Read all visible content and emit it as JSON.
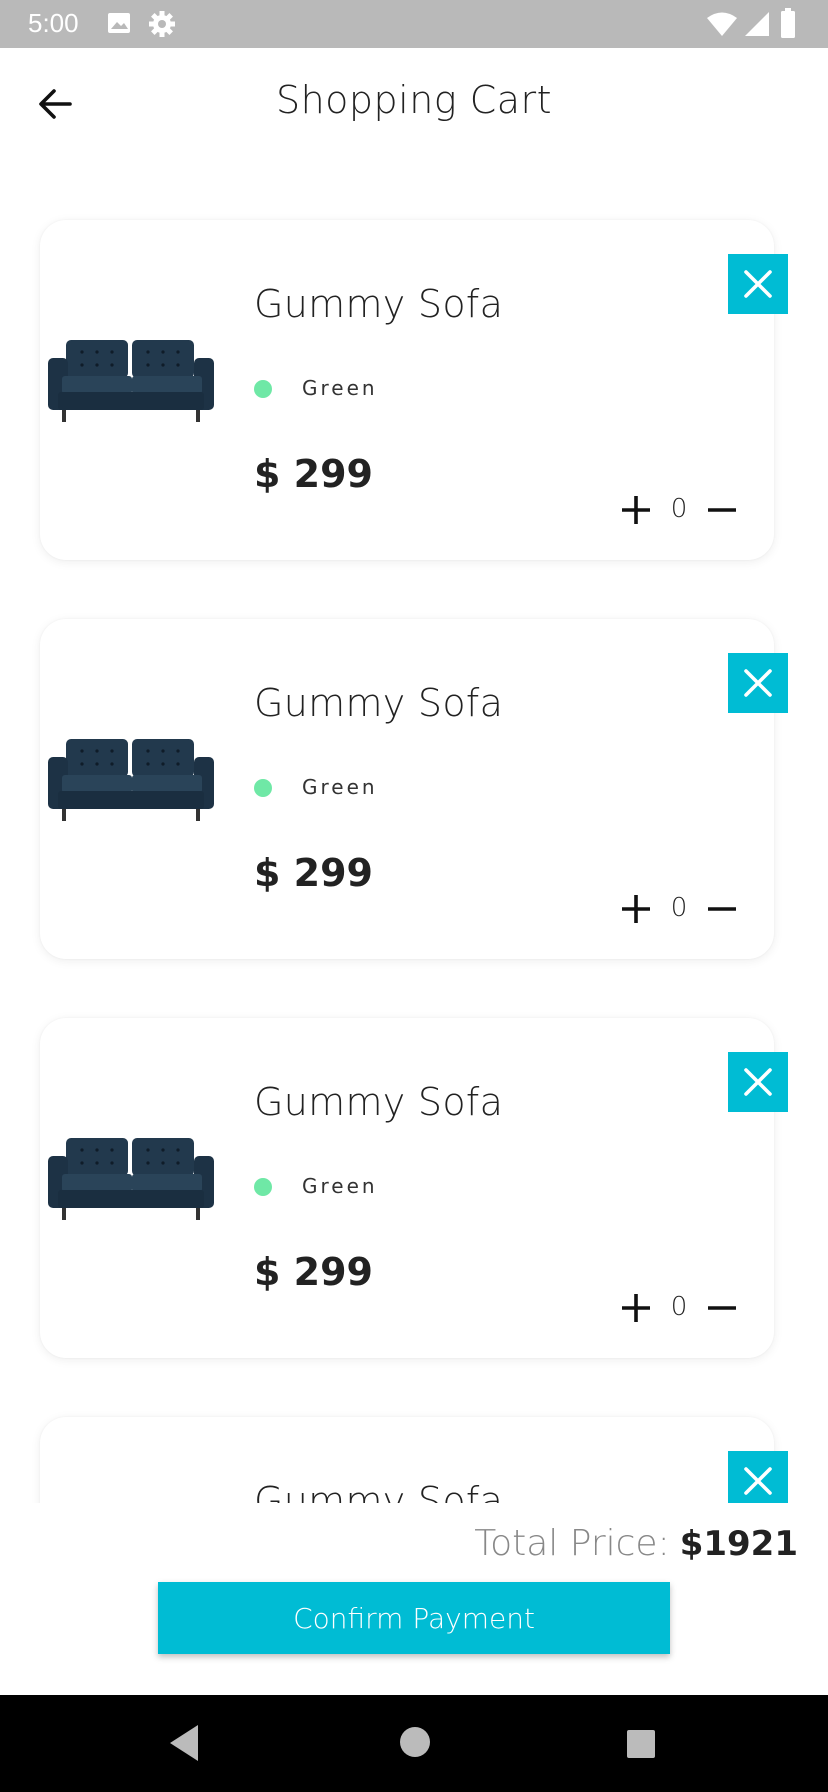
{
  "status_bar": {
    "time": "5:00",
    "icons": [
      "image-icon",
      "settings-icon",
      "wifi-icon",
      "signal-icon",
      "battery-icon"
    ]
  },
  "header": {
    "title": "Shopping Cart",
    "back_icon": "arrow-left-icon"
  },
  "cart": {
    "items": [
      {
        "name": "Gummy Sofa",
        "color_name": "Green",
        "color_hex": "#6fe8a6",
        "price": "$ 299",
        "quantity": "0"
      },
      {
        "name": "Gummy Sofa",
        "color_name": "Green",
        "color_hex": "#6fe8a6",
        "price": "$ 299",
        "quantity": "0"
      },
      {
        "name": "Gummy Sofa",
        "color_name": "Green",
        "color_hex": "#6fe8a6",
        "price": "$ 299",
        "quantity": "0"
      },
      {
        "name": "Gummy Sofa"
      }
    ]
  },
  "footer": {
    "total_label": "Total Price:",
    "total_value": "$1921",
    "confirm_label": "Confirm Payment"
  },
  "colors": {
    "accent": "#00bcd4",
    "status_bar": "#b9b9b9",
    "nav_bar": "#000000"
  }
}
